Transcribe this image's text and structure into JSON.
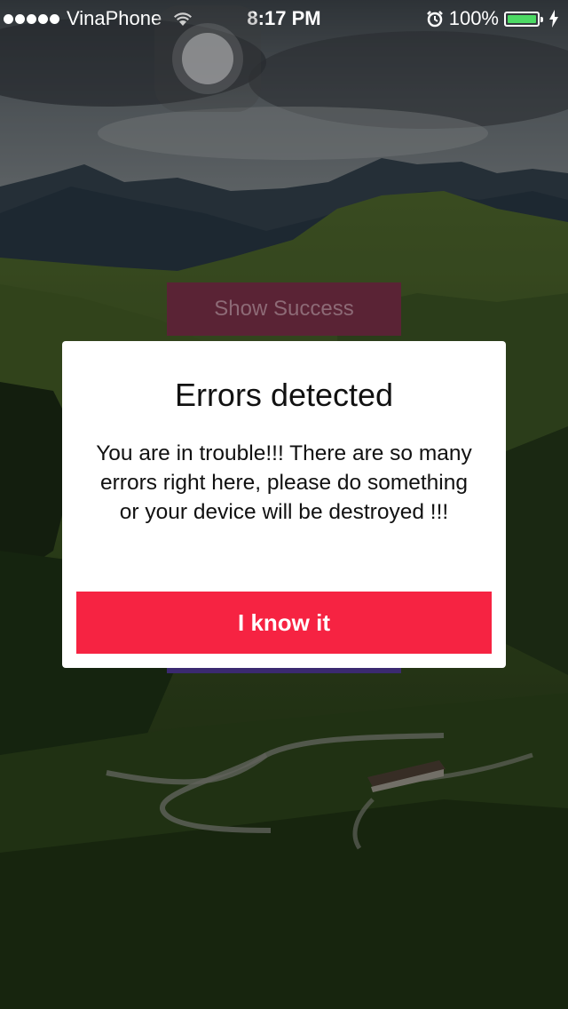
{
  "status_bar": {
    "carrier": "VinaPhone",
    "time": "8:17 PM",
    "battery_percent": "100%",
    "battery_level": 1.0,
    "signal_bars": 5,
    "icons": [
      "signal-dots-icon",
      "wifi-icon",
      "alarm-icon",
      "battery-icon",
      "charging-bolt-icon"
    ]
  },
  "background_screen": {
    "show_success_label": "Show Success"
  },
  "alert": {
    "title": "Errors detected",
    "message": "You are in trouble!!! There are so many errors right here, please do something or your device will be destroyed !!!",
    "button_label": "I know it",
    "button_color": "#f62342"
  },
  "colors": {
    "battery_green": "#4cd964",
    "overlay_dim": "rgba(0,0,0,0.38)"
  }
}
